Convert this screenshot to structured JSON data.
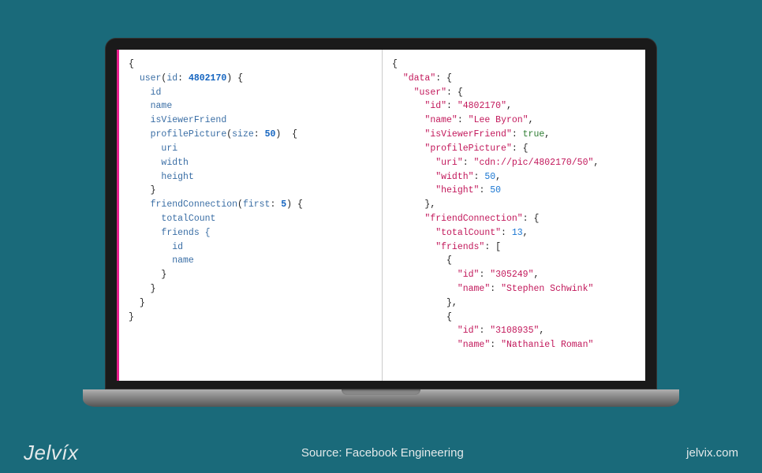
{
  "query": {
    "id": 4802170,
    "picSize": 50,
    "friendsFirst": 5,
    "fields": [
      "id",
      "name",
      "isViewerFriend"
    ],
    "picFields": [
      "uri",
      "width",
      "height"
    ],
    "friendFields": [
      "totalCount",
      "friends { id name }"
    ]
  },
  "response": {
    "data": {
      "user": {
        "id": "4802170",
        "name": "Lee Byron",
        "isViewerFriend": true,
        "profilePicture": {
          "uri": "cdn://pic/4802170/50",
          "width": 50,
          "height": 50
        },
        "friendConnection": {
          "totalCount": 13,
          "friends": [
            {
              "id": "305249",
              "name": "Stephen Schwink"
            },
            {
              "id": "3108935",
              "name": "Nathaniel Roman"
            }
          ]
        }
      }
    }
  },
  "footer": {
    "brand": "Jelvíx",
    "sourceLabel": "Source",
    "sourceValue": "Facebook Engineering",
    "url": "jelvix.com"
  }
}
